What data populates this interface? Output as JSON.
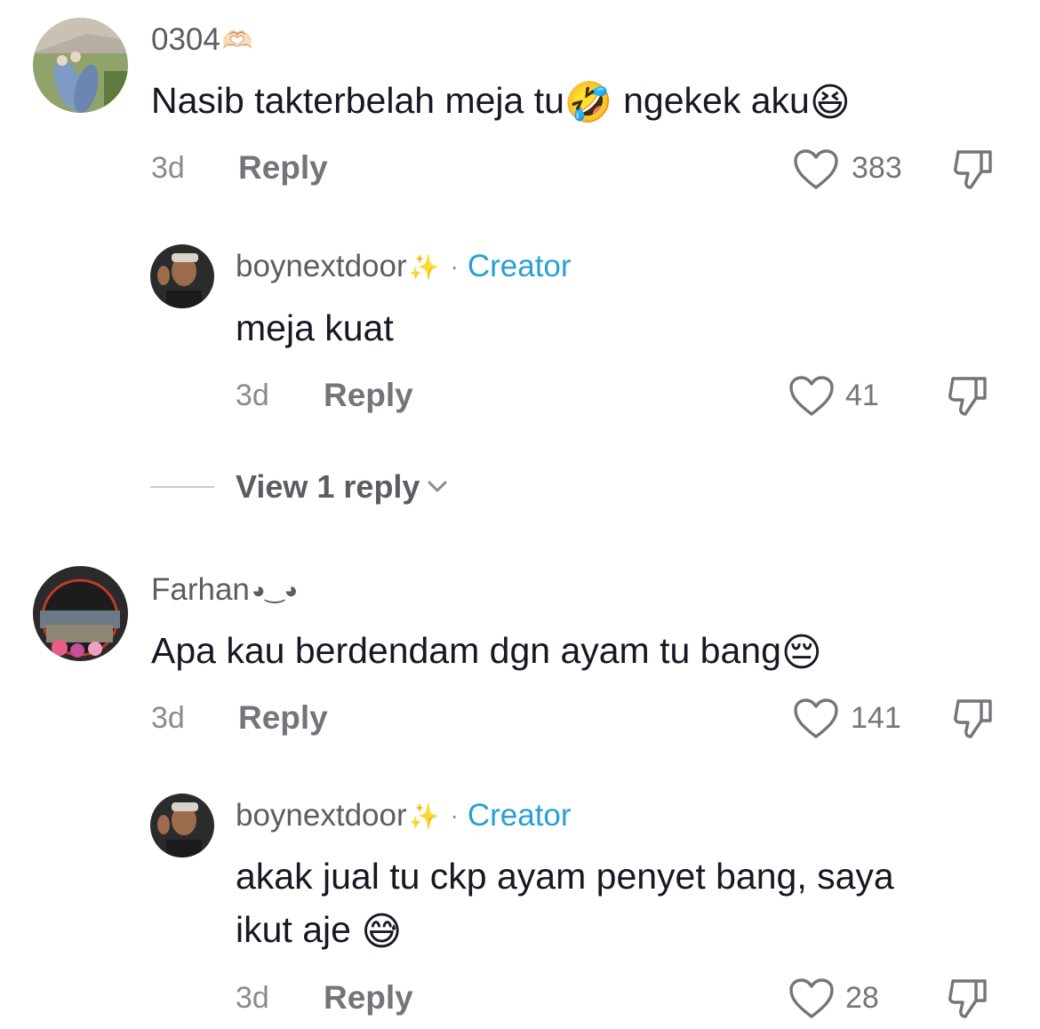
{
  "comments": [
    {
      "username": "0304",
      "username_deco": "🫶🏻",
      "text": "Nasib takterbelah meja tu",
      "emoji1": "🤣",
      "text2": " ngekek aku",
      "emoji2": "😆",
      "time": "3d",
      "reply_label": "Reply",
      "likes": "383",
      "reply": {
        "username": "boynextdoor",
        "username_deco": "✨",
        "separator": "·",
        "badge": "Creator",
        "text": "meja kuat",
        "time": "3d",
        "reply_label": "Reply",
        "likes": "41"
      },
      "view_more": "View 1 reply"
    },
    {
      "username": "Farhan",
      "username_deco": "◕‿◕",
      "text": "Apa kau berdendam dgn ayam tu bang",
      "emoji1": "😔",
      "time": "3d",
      "reply_label": "Reply",
      "likes": "141",
      "reply": {
        "username": "boynextdoor",
        "username_deco": "✨",
        "separator": "·",
        "badge": "Creator",
        "text_line1": "akak jual tu ckp ayam penyet bang, saya",
        "text_line2": "ikut aje ",
        "emoji": "😅",
        "time": "3d",
        "reply_label": "Reply",
        "likes": "28"
      }
    }
  ],
  "icons": {
    "like": "heart-outline-icon",
    "dislike": "thumbs-down-icon",
    "expand": "chevron-down-icon"
  }
}
